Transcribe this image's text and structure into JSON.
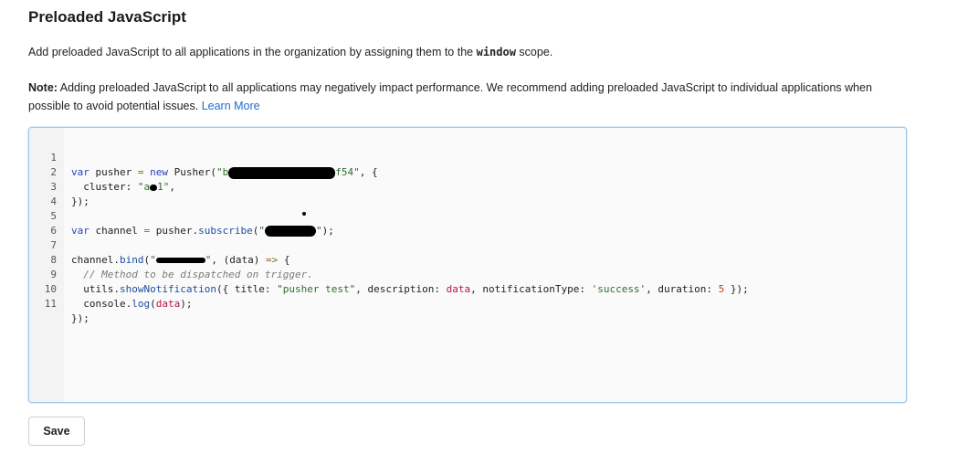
{
  "header": {
    "title": "Preloaded JavaScript"
  },
  "intro": {
    "text_before": "Add preloaded JavaScript to all applications in the organization by assigning them to the ",
    "code_word": "window",
    "text_after": " scope."
  },
  "note": {
    "label": "Note:",
    "text": " Adding preloaded JavaScript to all applications may negatively impact performance. We recommend adding preloaded JavaScript to individual applications when possible to avoid potential issues. ",
    "link": "Learn More"
  },
  "editor": {
    "line_numbers": [
      "1",
      "2",
      "3",
      "4",
      "5",
      "6",
      "7",
      "8",
      "9",
      "10",
      "11"
    ],
    "l1": {
      "kw": "var",
      "id": " pusher ",
      "eq": "=",
      "kw2": " new",
      "fn": " Pusher(",
      "str_a": "\"b",
      "str_b": "f54\"",
      "tail": ", {"
    },
    "l2": {
      "prop": "  cluster: ",
      "str_a": "\"a",
      "str_b": "1\"",
      "tail": ","
    },
    "l3": {
      "text": "});"
    },
    "l5": {
      "kw": "var",
      "id": " channel ",
      "eq": "=",
      "rest": " pusher.",
      "fn": "subscribe",
      "open": "(",
      "str_a": "\"",
      "str_b": "\"",
      "tail": ");"
    },
    "l7": {
      "obj": "channel.",
      "fn": "bind",
      "open": "(",
      "str_a": "\"",
      "str_b": "\"",
      "mid": ", (data) ",
      "arrow": "=>",
      "tail": " {"
    },
    "l8": {
      "comment": "  // Method to be dispatched on trigger."
    },
    "l9": {
      "a": "  utils.",
      "fn": "showNotification",
      "b": "({ title: ",
      "s1": "\"pusher test\"",
      "c": ", description: ",
      "v": "data",
      "d": ", notificationType: ",
      "s2": "'success'",
      "e": ", duration: ",
      "n": "5",
      "f": " });"
    },
    "l10": {
      "a": "  console.",
      "fn": "log",
      "b": "(",
      "v": "data",
      "c": ");"
    },
    "l11": {
      "text": "});"
    }
  },
  "actions": {
    "save_label": "Save"
  },
  "colors": {
    "accent": "#1a6fc9",
    "editor_border": "#9cc9ee"
  }
}
